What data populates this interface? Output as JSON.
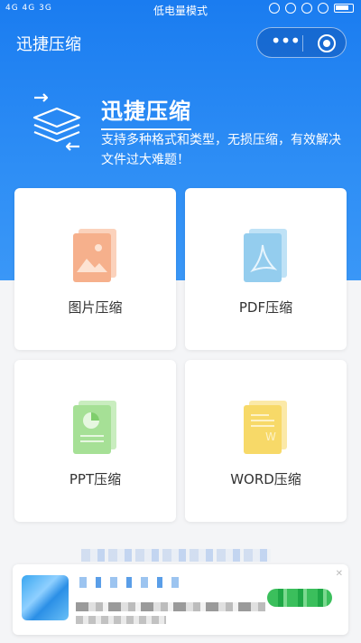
{
  "status_bar": {
    "network": "4G 4G 3G",
    "mode": "低电量模式"
  },
  "nav": {
    "title": "迅捷压缩",
    "more_label": "•••"
  },
  "banner": {
    "title": "迅捷压缩",
    "description": "支持多种格式和类型，无损压缩，有效解决文件过大难题！"
  },
  "cards": [
    {
      "label": "图片压缩",
      "icon": "image-file-icon",
      "color": "#f2a27a"
    },
    {
      "label": "PDF压缩",
      "icon": "pdf-file-icon",
      "color": "#62b6e8"
    },
    {
      "label": "PPT压缩",
      "icon": "ppt-file-icon",
      "color": "#79cf6f"
    },
    {
      "label": "WORD压缩",
      "icon": "word-file-icon",
      "color": "#f0c94d"
    }
  ],
  "colors": {
    "primary": "#1a7cf0",
    "card_bg": "#ffffff",
    "page_bg": "#f4f5f7"
  }
}
